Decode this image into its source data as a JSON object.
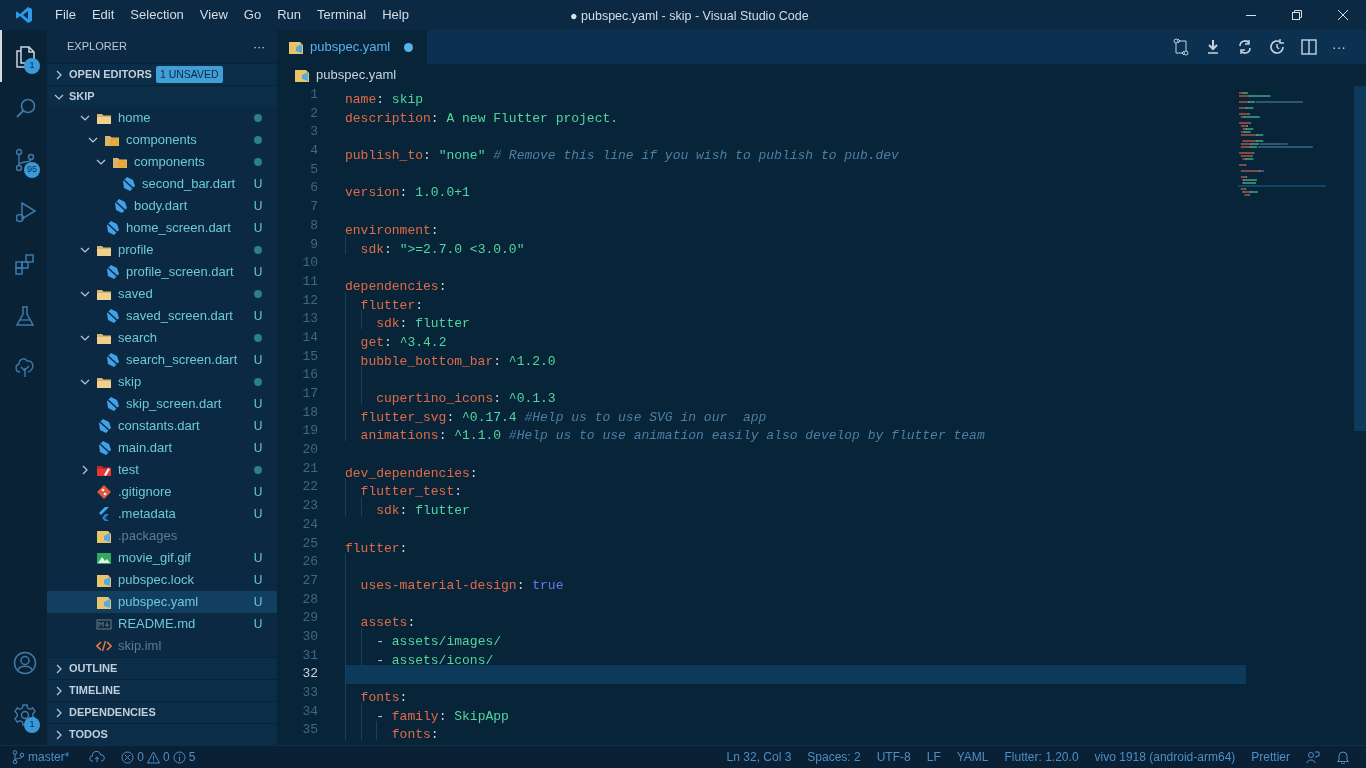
{
  "window": {
    "title": "● pubspec.yaml - skip - Visual Studio Code"
  },
  "menu": [
    "File",
    "Edit",
    "Selection",
    "View",
    "Go",
    "Run",
    "Terminal",
    "Help"
  ],
  "activity_bar": {
    "top": [
      {
        "kind": "explorer",
        "selected": true,
        "badge": "1"
      },
      {
        "kind": "search",
        "selected": false
      },
      {
        "kind": "source-control",
        "selected": false,
        "badge": "95"
      },
      {
        "kind": "run",
        "selected": false
      },
      {
        "kind": "extensions",
        "selected": false
      },
      {
        "kind": "testing",
        "selected": false
      },
      {
        "kind": "tree",
        "selected": false
      }
    ],
    "bottom": [
      {
        "kind": "account",
        "selected": false
      },
      {
        "kind": "settings",
        "selected": false,
        "badge": "1"
      }
    ]
  },
  "sidebar": {
    "title": "EXPLORER",
    "more": "···",
    "open_editors": {
      "label": "OPEN EDITORS",
      "expanded": false,
      "badge": "1 UNSAVED"
    },
    "project": {
      "label": "SKIP",
      "expanded": true,
      "tree": [
        {
          "name": "home",
          "kind": "folder",
          "expanded": true,
          "dot": true,
          "ignored": false,
          "selected": false,
          "children": [
            {
              "name": "components",
              "kind": "folder-gear",
              "expanded": true,
              "dot": true,
              "ignored": false,
              "selected": false,
              "children": [
                {
                  "name": "components",
                  "kind": "folder-gear",
                  "expanded": true,
                  "dot": true,
                  "ignored": false,
                  "selected": false,
                  "children": [
                    {
                      "name": "second_bar.dart",
                      "kind": "dart",
                      "badge": "U",
                      "dot": false,
                      "ignored": false,
                      "selected": false
                    }
                  ]
                },
                {
                  "name": "body.dart",
                  "kind": "dart",
                  "badge": "U",
                  "dot": false,
                  "ignored": false,
                  "selected": false
                }
              ]
            },
            {
              "name": "home_screen.dart",
              "kind": "dart",
              "badge": "U",
              "dot": false,
              "ignored": false,
              "selected": false
            }
          ]
        },
        {
          "name": "profile",
          "kind": "folder",
          "expanded": true,
          "dot": true,
          "ignored": false,
          "selected": false,
          "children": [
            {
              "name": "profile_screen.dart",
              "kind": "dart",
              "badge": "U",
              "dot": false,
              "ignored": false,
              "selected": false
            }
          ]
        },
        {
          "name": "saved",
          "kind": "folder",
          "expanded": true,
          "dot": true,
          "ignored": false,
          "selected": false,
          "children": [
            {
              "name": "saved_screen.dart",
              "kind": "dart",
              "badge": "U",
              "dot": false,
              "ignored": false,
              "selected": false
            }
          ]
        },
        {
          "name": "search",
          "kind": "folder",
          "expanded": true,
          "dot": true,
          "ignored": false,
          "selected": false,
          "children": [
            {
              "name": "search_screen.dart",
              "kind": "dart",
              "badge": "U",
              "dot": false,
              "ignored": false,
              "selected": false
            }
          ]
        },
        {
          "name": "skip",
          "kind": "folder",
          "expanded": true,
          "dot": true,
          "ignored": false,
          "selected": false,
          "children": [
            {
              "name": "skip_screen.dart",
              "kind": "dart",
              "badge": "U",
              "dot": false,
              "ignored": false,
              "selected": false
            }
          ]
        },
        {
          "name": "constants.dart",
          "kind": "dart",
          "badge": "U",
          "dot": false,
          "ignored": false,
          "selected": false
        },
        {
          "name": "main.dart",
          "kind": "dart",
          "badge": "U",
          "dot": false,
          "ignored": false,
          "selected": false
        },
        {
          "name": "test",
          "kind": "folder-test",
          "expanded": false,
          "dot": true,
          "ignored": false,
          "selected": false
        },
        {
          "name": ".gitignore",
          "kind": "git",
          "badge": "U",
          "dot": false,
          "ignored": false,
          "selected": false
        },
        {
          "name": ".metadata",
          "kind": "flutter",
          "badge": "U",
          "dot": false,
          "ignored": false,
          "selected": false
        },
        {
          "name": ".packages",
          "kind": "yaml",
          "dot": false,
          "ignored": true,
          "selected": false
        },
        {
          "name": "movie_gif.gif",
          "kind": "image",
          "badge": "U",
          "dot": false,
          "ignored": false,
          "selected": false
        },
        {
          "name": "pubspec.lock",
          "kind": "yaml",
          "badge": "U",
          "dot": false,
          "ignored": false,
          "selected": false
        },
        {
          "name": "pubspec.yaml",
          "kind": "yaml",
          "badge": "U",
          "dot": false,
          "ignored": false,
          "selected": true
        },
        {
          "name": "README.md",
          "kind": "markdown",
          "badge": "U",
          "dot": false,
          "ignored": false,
          "selected": false
        },
        {
          "name": "skip.iml",
          "kind": "xml",
          "dot": false,
          "ignored": true,
          "selected": false
        }
      ]
    },
    "sections": [
      {
        "label": "OUTLINE",
        "expanded": false
      },
      {
        "label": "TIMELINE",
        "expanded": false
      },
      {
        "label": "DEPENDENCIES",
        "expanded": false
      },
      {
        "label": "TODOS",
        "expanded": false
      }
    ]
  },
  "tabs": [
    {
      "label": "pubspec.yaml",
      "kind": "yaml",
      "dirty": true,
      "selected": true
    }
  ],
  "editor_actions": [
    {
      "kind": "compare"
    },
    {
      "kind": "download"
    },
    {
      "kind": "sync"
    },
    {
      "kind": "history"
    },
    {
      "kind": "split"
    },
    {
      "kind": "more",
      "label": "···"
    }
  ],
  "breadcrumb": {
    "label": "pubspec.yaml",
    "kind": "yaml"
  },
  "lines": [
    {
      "number": "1",
      "current": false,
      "tokens": [
        {
          "kind": "key",
          "text": "name"
        },
        {
          "kind": "punct",
          "text": ": "
        },
        {
          "kind": "str",
          "text": "skip"
        }
      ]
    },
    {
      "number": "2",
      "current": false,
      "tokens": [
        {
          "kind": "key",
          "text": "description"
        },
        {
          "kind": "punct",
          "text": ": "
        },
        {
          "kind": "str",
          "text": "A new Flutter project."
        }
      ]
    },
    {
      "number": "3",
      "current": false
    },
    {
      "number": "4",
      "current": false,
      "tokens": [
        {
          "kind": "key",
          "text": "publish_to"
        },
        {
          "kind": "punct",
          "text": ": "
        },
        {
          "kind": "str",
          "text": "\"none\""
        },
        {
          "kind": "comment",
          "text": " # Remove this line if you wish to publish to pub.dev"
        }
      ]
    },
    {
      "number": "5",
      "current": false
    },
    {
      "number": "6",
      "current": false,
      "tokens": [
        {
          "kind": "key",
          "text": "version"
        },
        {
          "kind": "punct",
          "text": ": "
        },
        {
          "kind": "str",
          "text": "1.0.0+1"
        }
      ]
    },
    {
      "number": "7",
      "current": false
    },
    {
      "number": "8",
      "current": false,
      "tokens": [
        {
          "kind": "key",
          "text": "environment"
        },
        {
          "kind": "punct",
          "text": ":"
        }
      ]
    },
    {
      "number": "9",
      "current": false,
      "tokens": [
        {
          "kind": "key",
          "text": "  sdk"
        },
        {
          "kind": "punct",
          "text": ": "
        },
        {
          "kind": "str",
          "text": "\">=2.7.0 <3.0.0\""
        }
      ]
    },
    {
      "number": "10",
      "current": false
    },
    {
      "number": "11",
      "current": false,
      "tokens": [
        {
          "kind": "key",
          "text": "dependencies"
        },
        {
          "kind": "punct",
          "text": ":"
        }
      ]
    },
    {
      "number": "12",
      "current": false,
      "tokens": [
        {
          "kind": "key",
          "text": "  flutter"
        },
        {
          "kind": "punct",
          "text": ":"
        }
      ]
    },
    {
      "number": "13",
      "current": false,
      "tokens": [
        {
          "kind": "key",
          "text": "    sdk"
        },
        {
          "kind": "punct",
          "text": ": "
        },
        {
          "kind": "str",
          "text": "flutter"
        }
      ]
    },
    {
      "number": "14",
      "current": false,
      "tokens": [
        {
          "kind": "key",
          "text": "  get"
        },
        {
          "kind": "punct",
          "text": ": "
        },
        {
          "kind": "str",
          "text": "^3.4.2"
        }
      ]
    },
    {
      "number": "15",
      "current": false,
      "tokens": [
        {
          "kind": "key",
          "text": "  bubble_bottom_bar"
        },
        {
          "kind": "punct",
          "text": ": "
        },
        {
          "kind": "str",
          "text": "^1.2.0"
        }
      ]
    },
    {
      "number": "16",
      "current": false
    },
    {
      "number": "17",
      "current": false,
      "tokens": [
        {
          "kind": "key",
          "text": "    cupertino_icons"
        },
        {
          "kind": "punct",
          "text": ": "
        },
        {
          "kind": "str",
          "text": "^0.1.3"
        }
      ]
    },
    {
      "number": "18",
      "current": false,
      "tokens": [
        {
          "kind": "key",
          "text": "  flutter_svg"
        },
        {
          "kind": "punct",
          "text": ": "
        },
        {
          "kind": "str",
          "text": "^0.17.4"
        },
        {
          "kind": "comment",
          "text": " #Help us to use SVG in our  app"
        }
      ]
    },
    {
      "number": "19",
      "current": false,
      "tokens": [
        {
          "kind": "key",
          "text": "  animations"
        },
        {
          "kind": "punct",
          "text": ": "
        },
        {
          "kind": "str",
          "text": "^1.1.0"
        },
        {
          "kind": "comment",
          "text": " #Help us to use animation easily also develop by flutter team"
        }
      ]
    },
    {
      "number": "20",
      "current": false
    },
    {
      "number": "21",
      "current": false,
      "tokens": [
        {
          "kind": "key",
          "text": "dev_dependencies"
        },
        {
          "kind": "punct",
          "text": ":"
        }
      ]
    },
    {
      "number": "22",
      "current": false,
      "tokens": [
        {
          "kind": "key",
          "text": "  flutter_test"
        },
        {
          "kind": "punct",
          "text": ":"
        }
      ]
    },
    {
      "number": "23",
      "current": false,
      "tokens": [
        {
          "kind": "key",
          "text": "    sdk"
        },
        {
          "kind": "punct",
          "text": ": "
        },
        {
          "kind": "str",
          "text": "flutter"
        }
      ]
    },
    {
      "number": "24",
      "current": false
    },
    {
      "number": "25",
      "current": false,
      "tokens": [
        {
          "kind": "key",
          "text": "flutter"
        },
        {
          "kind": "punct",
          "text": ":"
        }
      ]
    },
    {
      "number": "26",
      "current": false
    },
    {
      "number": "27",
      "current": false,
      "tokens": [
        {
          "kind": "key",
          "text": "  uses-material-design"
        },
        {
          "kind": "punct",
          "text": ": "
        },
        {
          "kind": "bool",
          "text": "true"
        }
      ]
    },
    {
      "number": "28",
      "current": false
    },
    {
      "number": "29",
      "current": false,
      "tokens": [
        {
          "kind": "key",
          "text": "  assets"
        },
        {
          "kind": "punct",
          "text": ":"
        }
      ]
    },
    {
      "number": "30",
      "current": false,
      "tokens": [
        {
          "kind": "punct",
          "text": "    - "
        },
        {
          "kind": "str",
          "text": "assets/images/"
        }
      ]
    },
    {
      "number": "31",
      "current": false,
      "tokens": [
        {
          "kind": "punct",
          "text": "    - "
        },
        {
          "kind": "str",
          "text": "assets/icons/"
        }
      ]
    },
    {
      "number": "32",
      "current": true
    },
    {
      "number": "33",
      "current": false,
      "tokens": [
        {
          "kind": "key",
          "text": "  fonts"
        },
        {
          "kind": "punct",
          "text": ":"
        }
      ]
    },
    {
      "number": "34",
      "current": false,
      "tokens": [
        {
          "kind": "punct",
          "text": "    - "
        },
        {
          "kind": "key",
          "text": "family"
        },
        {
          "kind": "punct",
          "text": ": "
        },
        {
          "kind": "str",
          "text": "SkipApp"
        }
      ]
    },
    {
      "number": "35",
      "current": false,
      "tokens": [
        {
          "kind": "key",
          "text": "      fonts"
        },
        {
          "kind": "punct",
          "text": ":"
        }
      ]
    }
  ],
  "status_bar": {
    "branch": "master*",
    "errors": "0",
    "warnings": "0",
    "infos": "5",
    "right": [
      {
        "kind": "text",
        "text": "Ln 32, Col 3"
      },
      {
        "kind": "text",
        "text": "Spaces: 2"
      },
      {
        "kind": "text",
        "text": "UTF-8"
      },
      {
        "kind": "text",
        "text": "LF"
      },
      {
        "kind": "text",
        "text": "YAML"
      },
      {
        "kind": "text",
        "text": "Flutter: 1.20.0"
      },
      {
        "kind": "text",
        "text": "vivo 1918 (android-arm64)"
      },
      {
        "kind": "text",
        "text": "Prettier"
      },
      {
        "kind": "feedback"
      },
      {
        "kind": "bell"
      }
    ]
  }
}
